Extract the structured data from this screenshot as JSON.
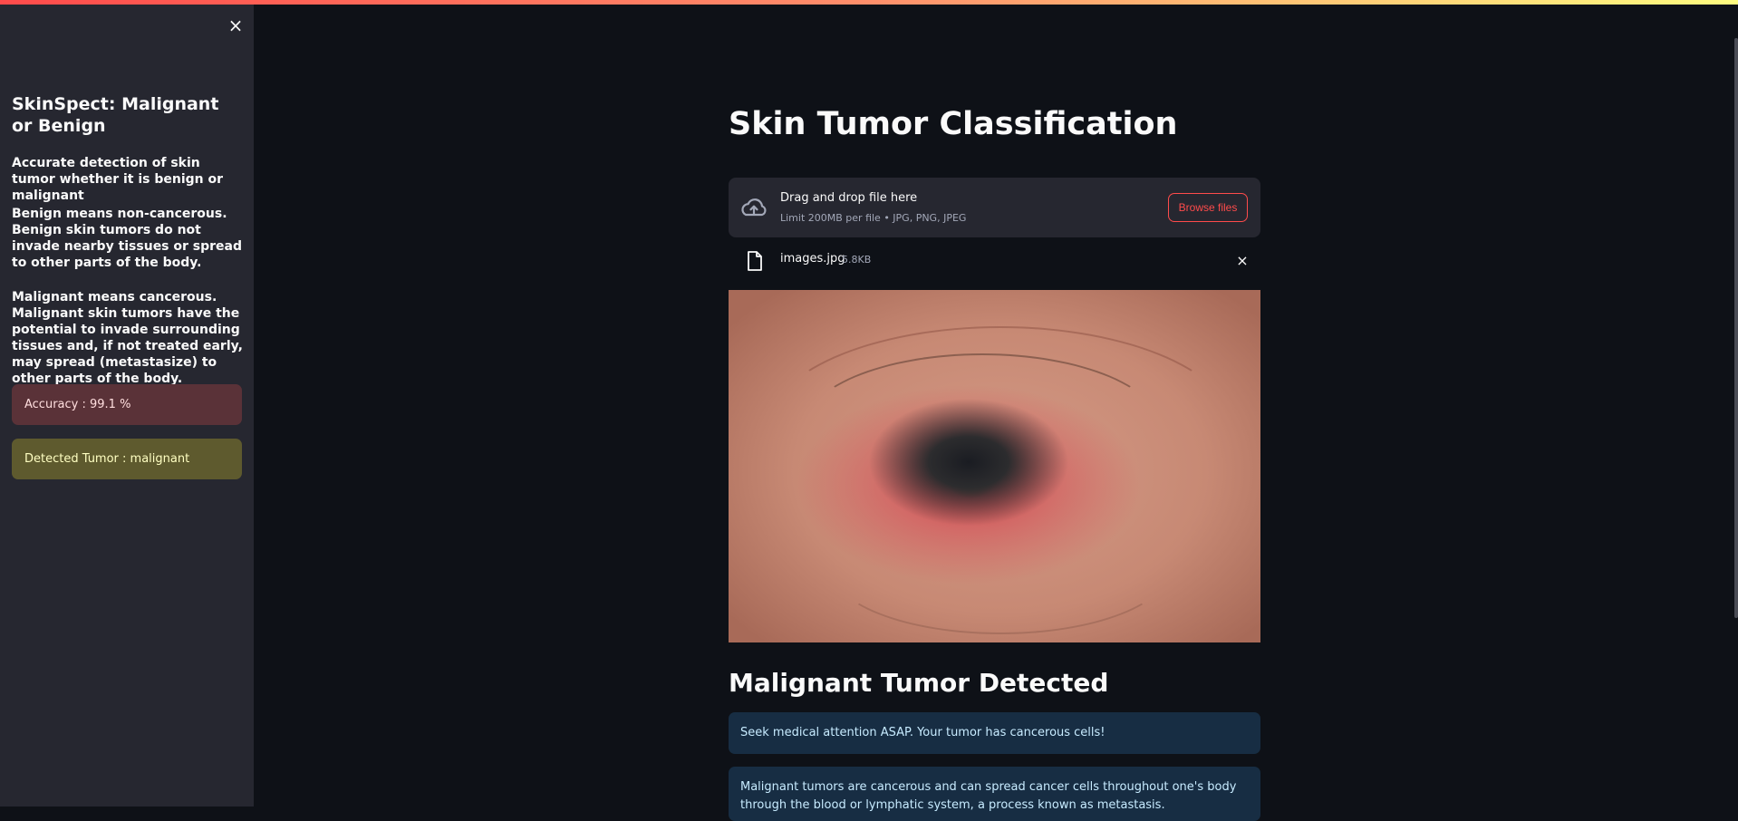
{
  "sidebar": {
    "title": "SkinSpect: Malignant or Benign",
    "intro": "Accurate detection of skin tumor whether it is benign or malignant",
    "benign_text": "Benign means non-cancerous. Benign skin tumors do not invade nearby tissues or spread to other parts of the body.",
    "malignant_text": "Malignant means cancerous. Malignant skin tumors have the potential to invade surrounding tissues and, if not treated early, may spread (metastasize) to other parts of the body.",
    "accuracy_alert": "Accuracy : 99.1 %",
    "detected_alert": "Detected Tumor : malignant",
    "close_icon": "×"
  },
  "main": {
    "title": "Skin Tumor Classification",
    "uploader": {
      "drop_text": "Drag and drop file here",
      "limit_text": "Limit 200MB per file • JPG, PNG, JPEG",
      "browse_label": "Browse files"
    },
    "file": {
      "name": "images.jpg",
      "size": "5.8KB",
      "remove_icon": "×"
    },
    "result_heading": "Malignant Tumor Detected",
    "info_1": "Seek medical attention ASAP. Your tumor has cancerous cells!",
    "info_2": "Malignant tumors are cancerous and can spread cancer cells throughout one's body through the blood or lymphatic system, a process known as metastasis."
  },
  "colors": {
    "background": "#0e1117",
    "sidebar": "#262730",
    "accent": "#ff4b4b",
    "info": "#172d43"
  },
  "icons": {
    "upload": "cloud-upload-icon",
    "file": "file-icon",
    "close": "close-icon"
  }
}
